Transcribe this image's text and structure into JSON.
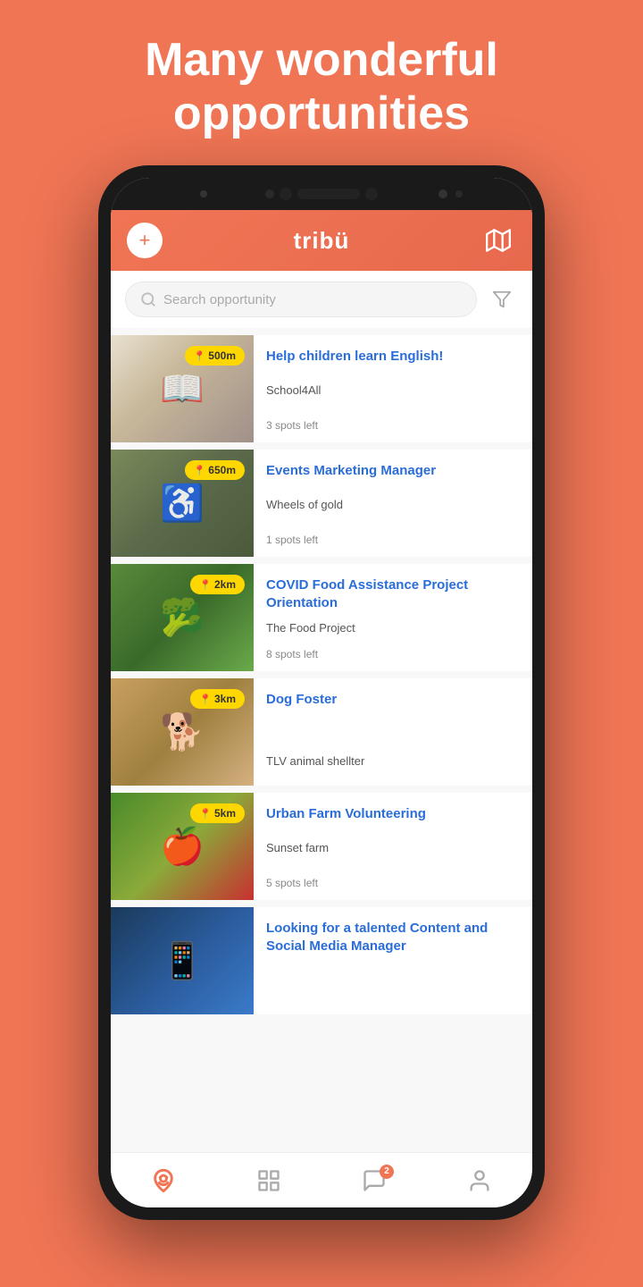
{
  "page": {
    "background_color": "#F07555",
    "title": "Many wonderful opportunities"
  },
  "header": {
    "plus_label": "+",
    "logo_text": "tribü",
    "map_label": "map"
  },
  "search": {
    "placeholder": "Search opportunity"
  },
  "opportunities": [
    {
      "id": 1,
      "title": "Help children learn English!",
      "org": "School4All",
      "distance": "500m",
      "spots": "3 spots left",
      "image_class": "img-books"
    },
    {
      "id": 2,
      "title": "Events Marketing Manager",
      "org": "Wheels of gold",
      "distance": "650m",
      "spots": "1 spots left",
      "image_class": "img-bike"
    },
    {
      "id": 3,
      "title": "COVID Food Assistance Project Orientation",
      "org": "The Food Project",
      "distance": "2km",
      "spots": "8 spots left",
      "image_class": "img-veggie"
    },
    {
      "id": 4,
      "title": "Dog Foster",
      "org": "TLV animal shellter",
      "distance": "3km",
      "spots": "",
      "image_class": "img-dog"
    },
    {
      "id": 5,
      "title": "Urban Farm Volunteering",
      "org": "Sunset farm",
      "distance": "5km",
      "spots": "5 spots left",
      "image_class": "img-farm"
    },
    {
      "id": 6,
      "title": "Looking for a talented Content and Social Media Manager",
      "org": "",
      "distance": "",
      "spots": "",
      "image_class": "img-social"
    }
  ],
  "bottom_nav": {
    "home_label": "home",
    "feed_label": "feed",
    "messages_label": "messages",
    "messages_badge": "2",
    "profile_label": "profile"
  }
}
